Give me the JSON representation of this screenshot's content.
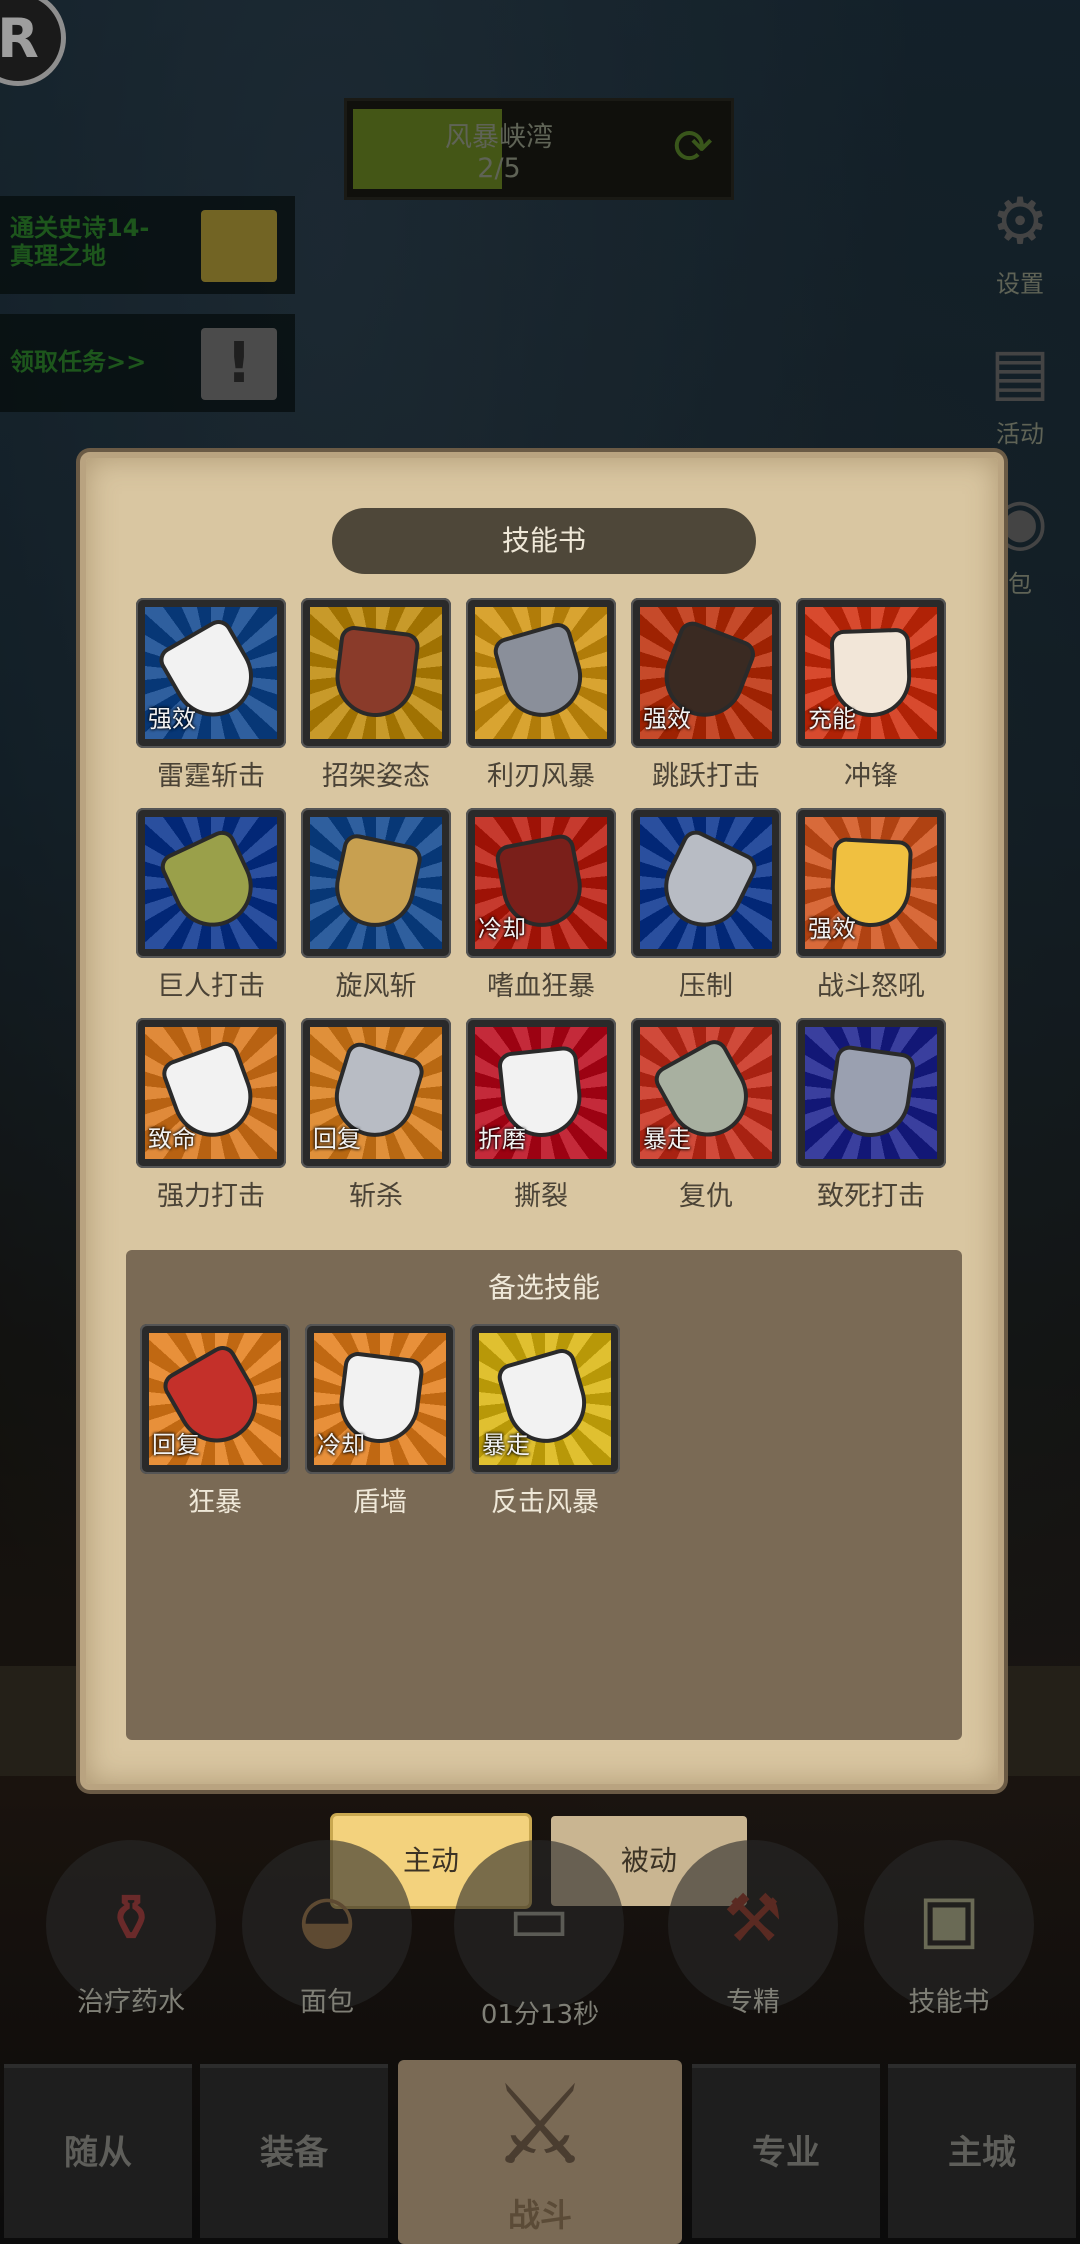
{
  "hud": {
    "logo_letter": "R",
    "stage": {
      "name": "风暴峡湾",
      "progress": "2/5",
      "progress_fraction": 0.4
    },
    "quests": [
      {
        "text_line1": "通关史诗14-",
        "text_line2": "真理之地",
        "icon": "gold-box-icon"
      },
      {
        "text_line1": "领取任务>>",
        "text_line2": "",
        "icon": "exclamation-icon"
      }
    ],
    "side_buttons": [
      {
        "label": "设置",
        "icon": "gear-icon"
      },
      {
        "label": "活动",
        "icon": "scroll-icon"
      },
      {
        "label": "包",
        "icon": "bag-icon"
      }
    ]
  },
  "skill_book": {
    "title": "技能书",
    "skills": [
      {
        "name": "雷霆斩击",
        "tag": "强效",
        "colors": [
          "#2f5f9e",
          "#f2f2f2"
        ]
      },
      {
        "name": "招架姿态",
        "tag": "",
        "colors": [
          "#c89a2a",
          "#8a3b2a"
        ]
      },
      {
        "name": "利刃风暴",
        "tag": "",
        "colors": [
          "#d9a431",
          "#8a8f9a"
        ]
      },
      {
        "name": "跳跃打击",
        "tag": "强效",
        "colors": [
          "#c64a2a",
          "#3a2a22"
        ]
      },
      {
        "name": "冲锋",
        "tag": "充能",
        "colors": [
          "#d84a2e",
          "#f2e6d8"
        ]
      },
      {
        "name": "巨人打击",
        "tag": "",
        "colors": [
          "#2a4f9e",
          "#9aa04a"
        ]
      },
      {
        "name": "旋风斩",
        "tag": "",
        "colors": [
          "#2f5f9e",
          "#c8a050"
        ]
      },
      {
        "name": "嗜血狂暴",
        "tag": "冷却",
        "colors": [
          "#c63a2e",
          "#7a1f1a"
        ]
      },
      {
        "name": "压制",
        "tag": "",
        "colors": [
          "#2a4f9e",
          "#b8bcc4"
        ]
      },
      {
        "name": "战斗怒吼",
        "tag": "强效",
        "colors": [
          "#d86a3a",
          "#f0c040"
        ]
      },
      {
        "name": "强力打击",
        "tag": "致命",
        "colors": [
          "#e08a3a",
          "#f2f2f2"
        ]
      },
      {
        "name": "斩杀",
        "tag": "回复",
        "colors": [
          "#e0903a",
          "#b8bcc4"
        ]
      },
      {
        "name": "撕裂",
        "tag": "折磨",
        "colors": [
          "#c42a3a",
          "#f2f2f2"
        ]
      },
      {
        "name": "复仇",
        "tag": "暴走",
        "colors": [
          "#d04a3a",
          "#a8b0a0"
        ]
      },
      {
        "name": "致死打击",
        "tag": "",
        "colors": [
          "#3a3f9e",
          "#9aa0b0"
        ]
      }
    ],
    "alternate_title": "备选技能",
    "alternate_skills": [
      {
        "name": "狂暴",
        "tag": "回复",
        "colors": [
          "#e8903a",
          "#c4302a"
        ]
      },
      {
        "name": "盾墙",
        "tag": "冷却",
        "colors": [
          "#e8903a",
          "#f2f2f2"
        ]
      },
      {
        "name": "反击风暴",
        "tag": "暴走",
        "colors": [
          "#e0c030",
          "#f2f2f2"
        ]
      }
    ]
  },
  "mode_tabs": {
    "active": "主动",
    "passive": "被动"
  },
  "bottom_actions": [
    {
      "label": "治疗药水",
      "icon": "potion-icon"
    },
    {
      "label": "面包",
      "icon": "bread-icon"
    },
    {
      "label": "",
      "icon": "chest-icon"
    },
    {
      "label": "专精",
      "icon": "anvil-icon"
    },
    {
      "label": "技能书",
      "icon": "book-icon"
    }
  ],
  "timer": "01分13秒",
  "nav": {
    "followers": "随从",
    "equipment": "装备",
    "battle": "战斗",
    "profession": "专业",
    "main_city": "主城"
  }
}
